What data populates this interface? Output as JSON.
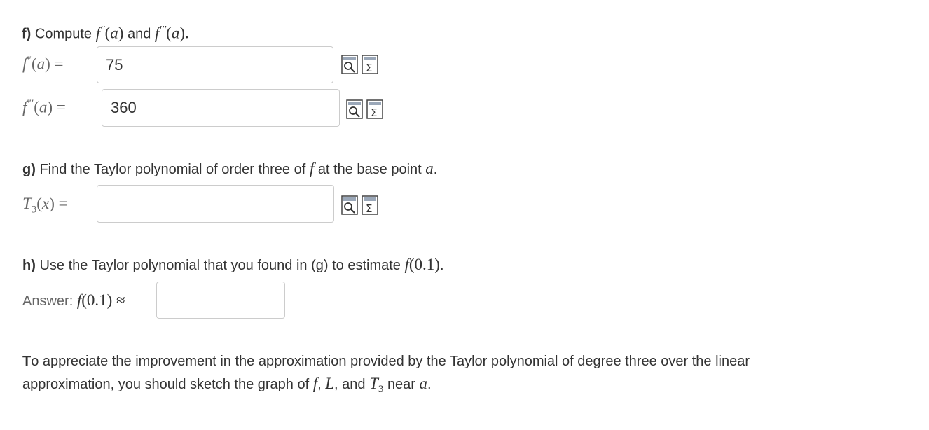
{
  "part_f": {
    "prefix": "f)",
    "text_before": "Compute",
    "and": "and",
    "answer_1": "75",
    "answer_2": "360"
  },
  "part_g": {
    "prefix": "g)",
    "text": "Find the Taylor polynomial of order three of",
    "text_after": "at the base point",
    "answer": ""
  },
  "part_h": {
    "prefix": "h)",
    "text": "Use the Taylor polynomial that you found in (g) to estimate",
    "answer_label": "Answer:",
    "answer": ""
  },
  "note": {
    "text_1": "o appreciate the improvement in the approximation provided by the Taylor polynomial of degree three over the linear",
    "text_2_before": "approximation, you should sketch the graph of",
    "text_2_and": "and",
    "text_2_near": "near",
    "first_letter": "T"
  },
  "icons": [
    "preview-icon",
    "equation-editor-icon"
  ]
}
